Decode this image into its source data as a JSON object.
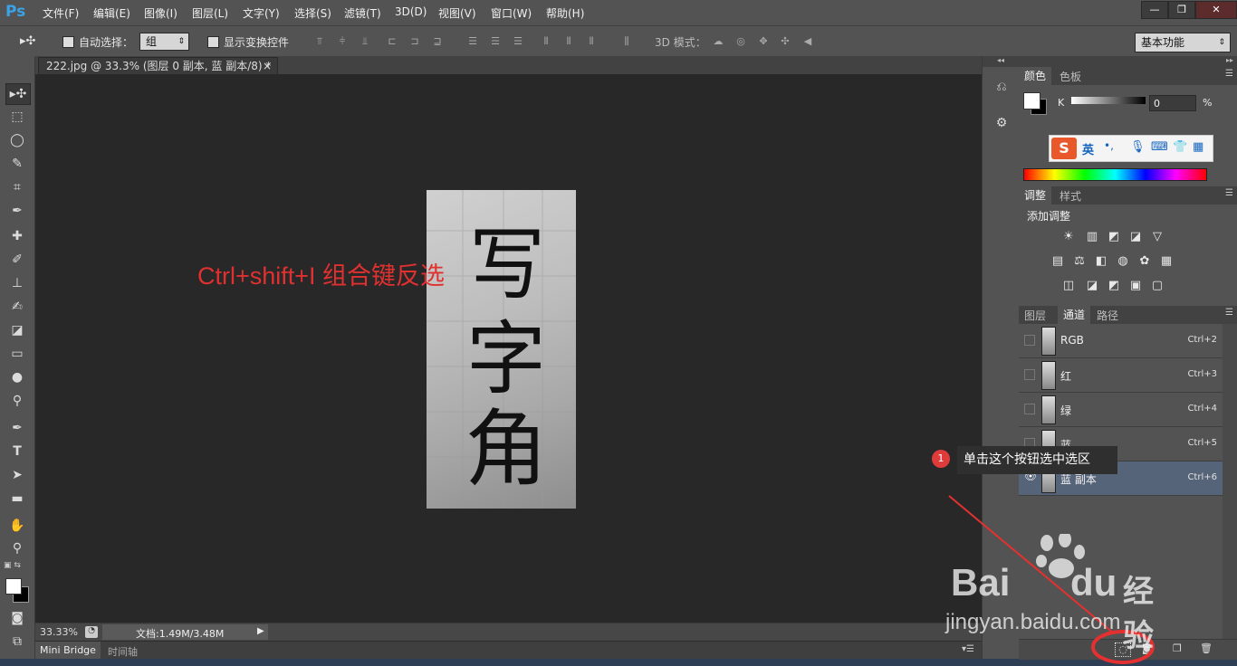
{
  "app": {
    "logo": "Ps"
  },
  "menu": [
    "文件(F)",
    "编辑(E)",
    "图像(I)",
    "图层(L)",
    "文字(Y)",
    "选择(S)",
    "滤镜(T)",
    "3D(D)",
    "视图(V)",
    "窗口(W)",
    "帮助(H)"
  ],
  "window_buttons": {
    "minimize": "—",
    "restore": "❐",
    "close": "✕"
  },
  "options": {
    "auto_select_label": "自动选择：",
    "auto_select_value": "组",
    "show_transform_label": "显示变换控件",
    "mode3d_label": "3D 模式：",
    "workspace": "基本功能"
  },
  "document": {
    "tab_title": "222.jpg @ 33.3% (图层 0 副本, 蓝 副本/8) *",
    "tab_close": "×",
    "zoom": "33.33%",
    "doc_info": "文档:1.49M/3.48M",
    "image_text_chars": [
      "写",
      "字",
      "角"
    ]
  },
  "annotation": {
    "hint": "Ctrl+shift+I  组合键反选",
    "tooltip": "单击这个按钮选中选区",
    "step_number": "1"
  },
  "bottom_tabs": {
    "mini_bridge": "Mini Bridge",
    "timeline": "时间轴"
  },
  "color_panel": {
    "tabs": [
      "颜色",
      "色板"
    ],
    "channel_label": "K",
    "value": "0",
    "unit": "%"
  },
  "ime_toolbar": {
    "logo": "S",
    "lang": "英",
    "punct": "•,",
    "icons": [
      "mic-icon",
      "keyboard-icon",
      "shirt-icon",
      "grid-icon"
    ]
  },
  "adjust_panel": {
    "tabs": [
      "调整",
      "样式"
    ],
    "title": "添加调整",
    "rows": [
      [
        "☀",
        "▥",
        "◩",
        "◪",
        "▽"
      ],
      [
        "▤",
        "⚖",
        "◧",
        "◍",
        "✿",
        "▦"
      ],
      [
        "◫",
        "◪",
        "◩",
        "▣",
        "▢"
      ]
    ]
  },
  "layers_panel": {
    "tabs": [
      "图层",
      "通道",
      "路径"
    ],
    "channels": [
      {
        "name": "RGB",
        "shortcut": "Ctrl+2",
        "visible": false,
        "selected": false
      },
      {
        "name": "红",
        "shortcut": "Ctrl+3",
        "visible": false,
        "selected": false
      },
      {
        "name": "绿",
        "shortcut": "Ctrl+4",
        "visible": false,
        "selected": false
      },
      {
        "name": "蓝",
        "shortcut": "Ctrl+5",
        "visible": false,
        "selected": false
      },
      {
        "name": "蓝 副本",
        "shortcut": "Ctrl+6",
        "visible": true,
        "selected": true
      }
    ]
  },
  "watermark": {
    "brand": "Bai",
    "brand2": "du",
    "site_name": "经验",
    "url": "jingyan.baidu.com"
  },
  "colors": {
    "ui_dark": "#282828",
    "panel": "#535353",
    "annotation_red": "#e03030",
    "selected_row": "#56647a"
  }
}
